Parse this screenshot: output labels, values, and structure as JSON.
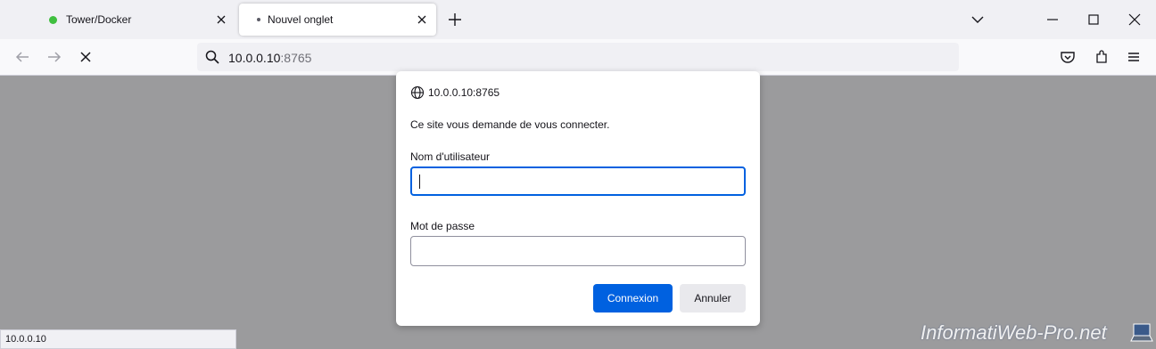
{
  "tabs": [
    {
      "label": "Tower/Docker",
      "status_color": "#3fbf3f"
    },
    {
      "label": "Nouvel onglet"
    }
  ],
  "nav": {
    "back_icon": "arrow-left-icon",
    "forward_icon": "arrow-right-icon",
    "stop_icon": "close-icon",
    "url_host": "10.0.0.10",
    "url_port": ":8765"
  },
  "dialog": {
    "origin": "10.0.0.10:8765",
    "message": "Ce site vous demande de vous connecter.",
    "username_label": "Nom d'utilisateur",
    "username_value": "",
    "password_label": "Mot de passe",
    "password_value": "",
    "ok_label": "Connexion",
    "cancel_label": "Annuler"
  },
  "status_text": "10.0.0.10",
  "watermark": "InformatiWeb-Pro.net",
  "colors": {
    "accent": "#0061e0",
    "backdrop": "#9b9b9d"
  }
}
